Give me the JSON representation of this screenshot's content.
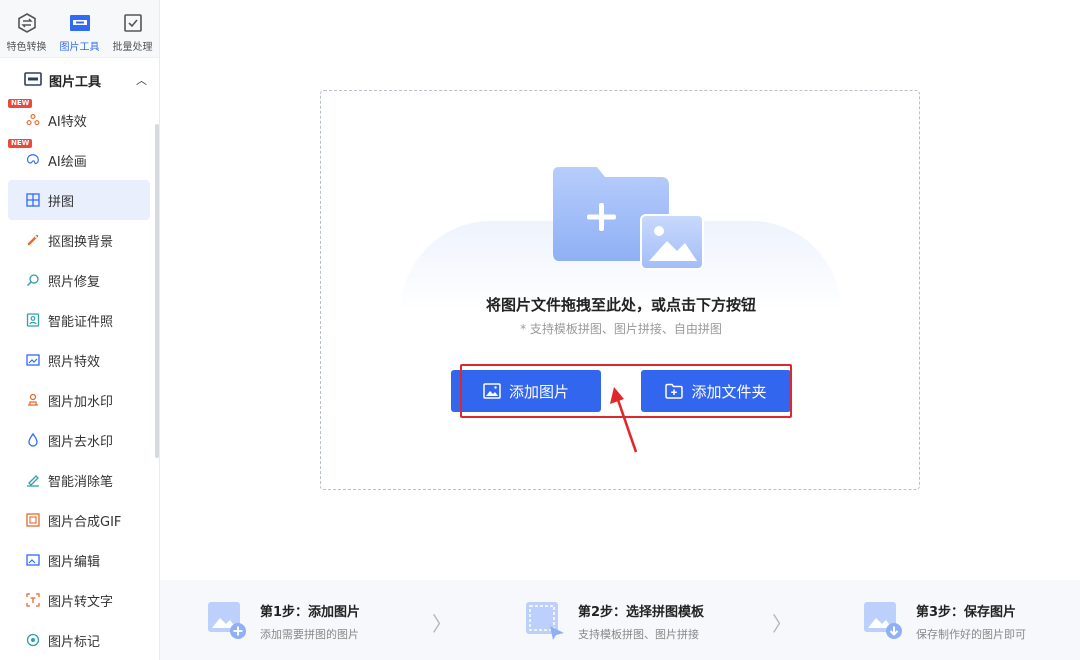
{
  "top_tabs": [
    {
      "label": "特色转换",
      "icon": "convert-icon"
    },
    {
      "label": "图片工具",
      "icon": "image-tool-icon"
    },
    {
      "label": "批量处理",
      "icon": "batch-icon"
    }
  ],
  "group": {
    "title": "图片工具",
    "icon": "image-tool-icon"
  },
  "nav_items": [
    {
      "label": "AI特效",
      "badge": "NEW",
      "icon": "ai-effect-icon"
    },
    {
      "label": "AI绘画",
      "badge": "NEW",
      "icon": "ai-paint-icon"
    },
    {
      "label": "拼图",
      "icon": "collage-icon"
    },
    {
      "label": "抠图换背景",
      "icon": "cutout-icon"
    },
    {
      "label": "照片修复",
      "icon": "repair-icon"
    },
    {
      "label": "智能证件照",
      "icon": "id-photo-icon"
    },
    {
      "label": "照片特效",
      "icon": "photo-effect-icon"
    },
    {
      "label": "图片加水印",
      "icon": "add-watermark-icon"
    },
    {
      "label": "图片去水印",
      "icon": "remove-watermark-icon"
    },
    {
      "label": "智能消除笔",
      "icon": "eraser-pen-icon"
    },
    {
      "label": "图片合成GIF",
      "icon": "gif-icon"
    },
    {
      "label": "图片编辑",
      "icon": "edit-image-icon"
    },
    {
      "label": "图片转文字",
      "icon": "ocr-icon"
    },
    {
      "label": "图片标记",
      "icon": "mark-icon"
    }
  ],
  "drop_zone": {
    "title": "将图片文件拖拽至此处，或点击下方按钮",
    "hint": "* 支持模板拼图、图片拼接、自由拼图",
    "add_image_label": "添加图片",
    "add_folder_label": "添加文件夹"
  },
  "steps": [
    {
      "title": "第1步：添加图片",
      "desc": "添加需要拼图的图片"
    },
    {
      "title": "第2步：选择拼图模板",
      "desc": "支持模板拼图、图片拼接"
    },
    {
      "title": "第3步：保存图片",
      "desc": "保存制作好的图片即可"
    }
  ],
  "colors": {
    "accent": "#3366ee",
    "highlight": "#e0282a",
    "badge": "#e84a3c"
  }
}
